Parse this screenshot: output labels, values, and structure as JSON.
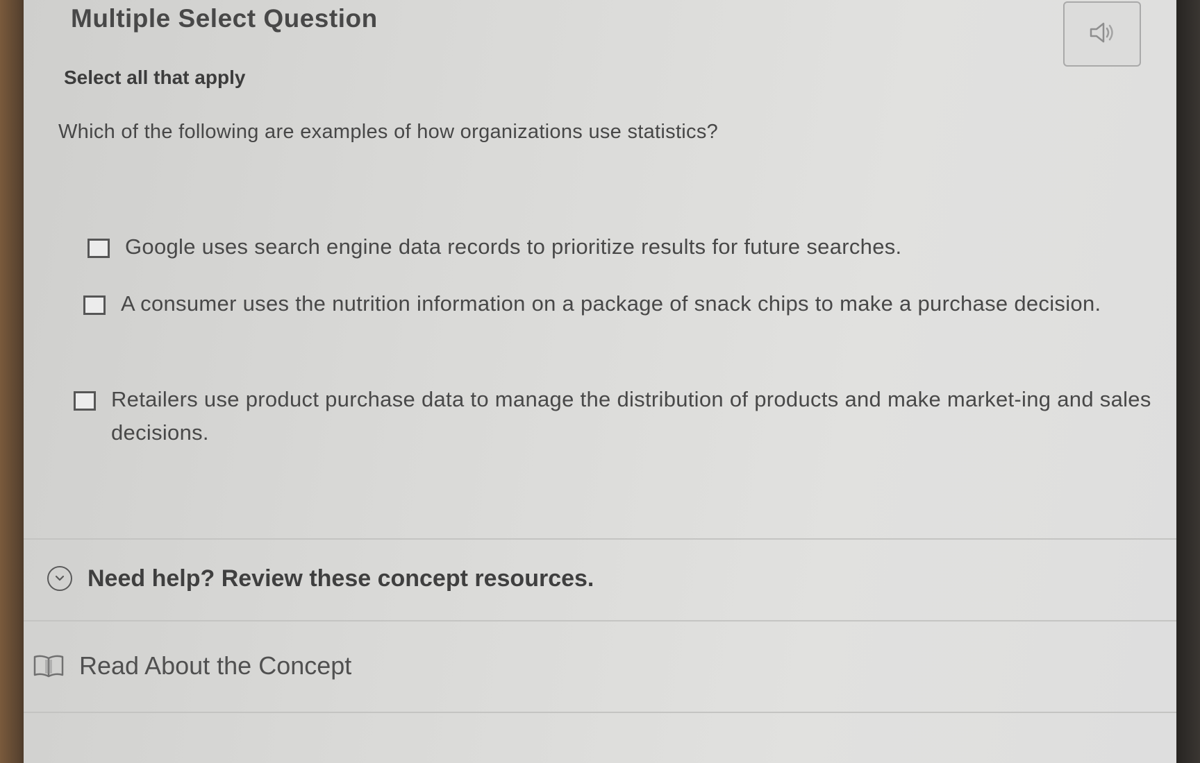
{
  "question": {
    "type_label": "Multiple Select Question",
    "instruction": "Select all that apply",
    "prompt": "Which of the following are examples of how organizations use statistics?",
    "audio_icon": "speaker-icon"
  },
  "options": [
    {
      "label": "Google uses search engine data records to prioritize results for future searches.",
      "checked": false
    },
    {
      "label": "A consumer uses the nutrition information on a package of snack chips to make a purchase decision.",
      "checked": false
    },
    {
      "label": "Retailers use product purchase data to manage the distribution of products and make market-ing and sales decisions.",
      "checked": false
    }
  ],
  "help": {
    "label": "Need help? Review these concept resources.",
    "icon": "chevron-down-icon"
  },
  "resources": [
    {
      "label": "Read About the Concept",
      "icon": "book-icon"
    }
  ]
}
